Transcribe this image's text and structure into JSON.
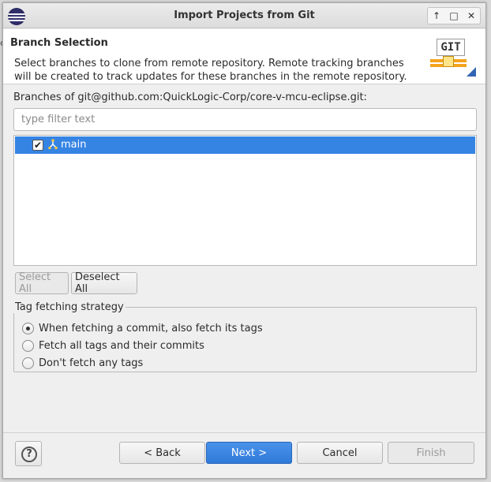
{
  "window": {
    "title": "Import Projects from Git",
    "controls": {
      "pin": "↑",
      "maximize": "□",
      "close": "✕"
    }
  },
  "header": {
    "title": "Branch Selection",
    "description": "Select branches to clone from remote repository. Remote tracking branches will be created to track updates for these branches in the remote repository.",
    "banner_text": "GIT"
  },
  "branches": {
    "label": "Branches of git@github.com:QuickLogic-Corp/core-v-mcu-eclipse.git:",
    "filter_placeholder": "type filter text",
    "filter_value": "",
    "items": [
      {
        "name": "main",
        "checked": true,
        "selected": true
      }
    ],
    "select_all_label": "Select All",
    "deselect_all_label": "Deselect All"
  },
  "tag_strategy": {
    "legend": "Tag fetching strategy",
    "options": [
      {
        "label": "When fetching a commit, also fetch its tags",
        "checked": true
      },
      {
        "label": "Fetch all tags and their commits",
        "checked": false
      },
      {
        "label": "Don't fetch any tags",
        "checked": false
      }
    ]
  },
  "footer": {
    "help_label": "?",
    "back_label": "< Back",
    "next_label": "Next >",
    "cancel_label": "Cancel",
    "finish_label": "Finish"
  },
  "colors": {
    "selection": "#3584e4",
    "primary_button": "#3584e4",
    "accent_orange": "#f4a31c"
  }
}
